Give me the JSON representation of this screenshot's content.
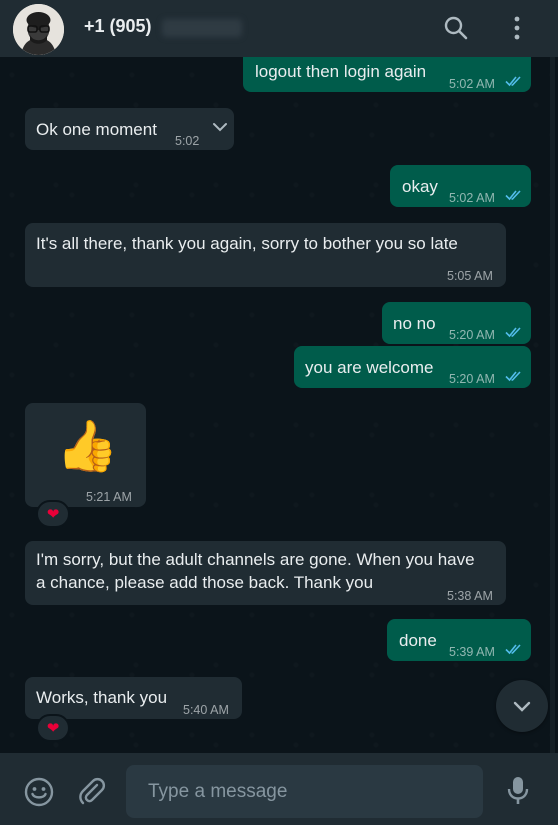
{
  "header": {
    "contact_name": "+1 (905)",
    "contact_name_obscured": true
  },
  "messages": [
    {
      "direction": "out",
      "text": "logout then login again",
      "time": "5:02 AM",
      "status": "read"
    },
    {
      "direction": "in",
      "text": "Ok one moment",
      "time": "5:02",
      "has_menu_chevron": true
    },
    {
      "direction": "out",
      "text": "okay",
      "time": "5:02 AM",
      "status": "read"
    },
    {
      "direction": "in",
      "text": "It's all there, thank you again, sorry to bother you so late",
      "time": "5:05 AM"
    },
    {
      "direction": "out",
      "text": "no no",
      "time": "5:20 AM",
      "status": "read"
    },
    {
      "direction": "out",
      "text": "you are welcome",
      "time": "5:20 AM",
      "status": "read"
    },
    {
      "direction": "in",
      "emoji": "👍",
      "time": "5:21 AM",
      "reaction": "❤"
    },
    {
      "direction": "in",
      "text_lines": [
        "I'm sorry, but the adult channels are gone. When you have",
        "a chance, please add those back. Thank you"
      ],
      "time": "5:38 AM"
    },
    {
      "direction": "out",
      "text": "done",
      "time": "5:39 AM",
      "status": "read"
    },
    {
      "direction": "in",
      "text": "Works, thank you",
      "time": "5:40 AM",
      "reaction": "❤"
    }
  ],
  "composer": {
    "placeholder": "Type a message"
  },
  "colors": {
    "background": "#0b141a",
    "header": "#202c33",
    "incoming_bubble": "#202c33",
    "outgoing_bubble": "#005c4b",
    "read_ticks": "#53bdeb",
    "reaction_heart": "#ea0038"
  },
  "icons": [
    "search-icon",
    "menu-icon",
    "emoji-icon",
    "attach-icon",
    "mic-icon",
    "chevron-down-icon",
    "double-check-icon"
  ]
}
